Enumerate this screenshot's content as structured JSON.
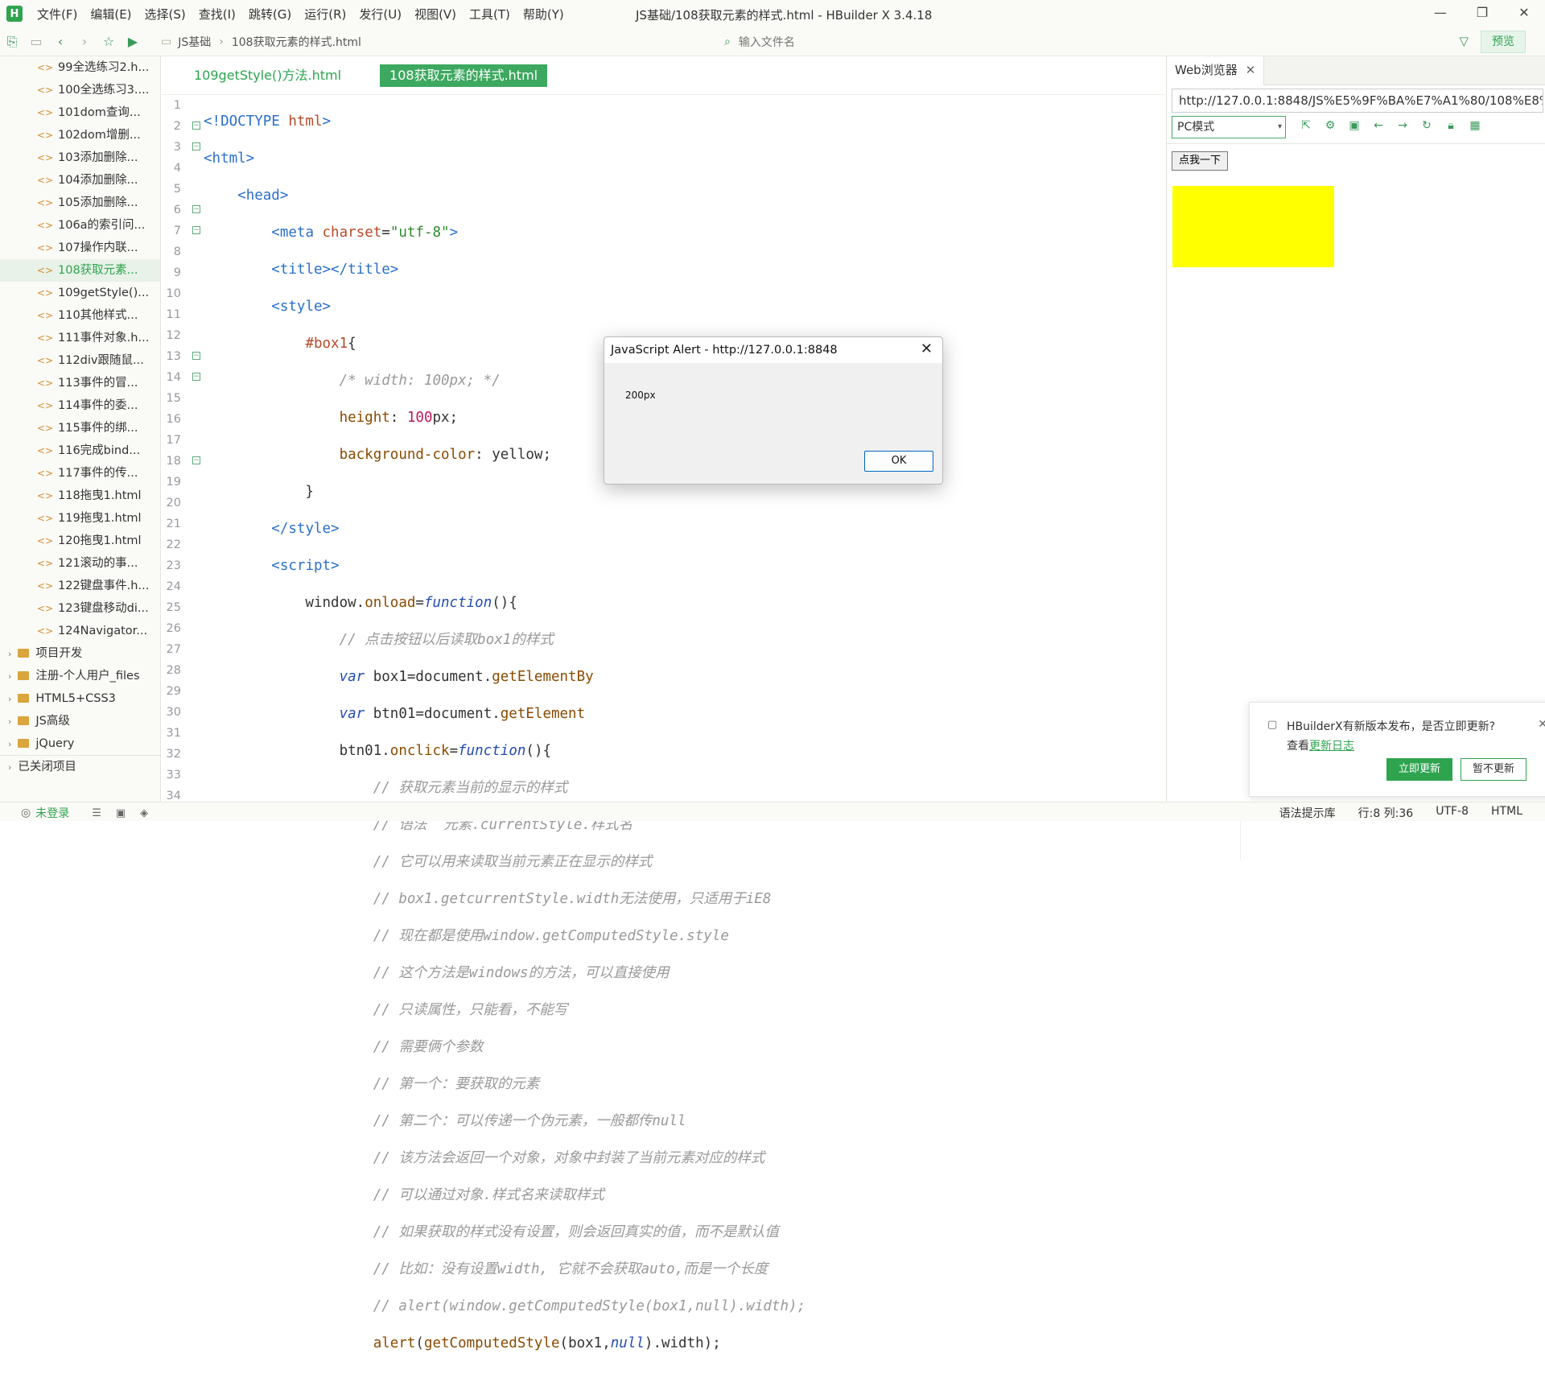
{
  "app": {
    "title": "JS基础/108获取元素的样式.html - HBuilder X 3.4.18",
    "logo_letter": "H",
    "menu": [
      "文件(F)",
      "编辑(E)",
      "选择(S)",
      "查找(I)",
      "跳转(G)",
      "运行(R)",
      "发行(U)",
      "视图(V)",
      "工具(T)",
      "帮助(Y)"
    ],
    "window_controls": [
      "—",
      "❐",
      "✕"
    ]
  },
  "toolbar": {
    "breadcrumb": [
      "JS基础",
      "108获取元素的样式.html"
    ],
    "file_search_placeholder": "输入文件名",
    "preview_label": "预览"
  },
  "sidebar": {
    "files": [
      {
        "icon": "<>",
        "label": "99全选练习2.h..."
      },
      {
        "icon": "<>",
        "label": "100全选练习3...."
      },
      {
        "icon": "<>",
        "label": "101dom查询..."
      },
      {
        "icon": "<>",
        "label": "102dom增删..."
      },
      {
        "icon": "<>",
        "label": "103添加删除..."
      },
      {
        "icon": "<>",
        "label": "104添加删除..."
      },
      {
        "icon": "<>",
        "label": "105添加删除..."
      },
      {
        "icon": "<>",
        "label": "106a的索引问..."
      },
      {
        "icon": "<>",
        "label": "107操作内联..."
      },
      {
        "icon": "<>",
        "label": "108获取元素...",
        "active": true
      },
      {
        "icon": "<>",
        "label": "109getStyle()..."
      },
      {
        "icon": "<>",
        "label": "110其他样式..."
      },
      {
        "icon": "<>",
        "label": "111事件对象.h..."
      },
      {
        "icon": "<>",
        "label": "112div跟随鼠..."
      },
      {
        "icon": "<>",
        "label": "113事件的冒..."
      },
      {
        "icon": "<>",
        "label": "114事件的委..."
      },
      {
        "icon": "<>",
        "label": "115事件的绑..."
      },
      {
        "icon": "<>",
        "label": "116完成bind..."
      },
      {
        "icon": "<>",
        "label": "117事件的传..."
      },
      {
        "icon": "<>",
        "label": "118拖曳1.html"
      },
      {
        "icon": "<>",
        "label": "119拖曳1.html"
      },
      {
        "icon": "<>",
        "label": "120拖曳1.html"
      },
      {
        "icon": "<>",
        "label": "121滚动的事..."
      },
      {
        "icon": "<>",
        "label": "122键盘事件.h..."
      },
      {
        "icon": "<>",
        "label": "123键盘移动di..."
      },
      {
        "icon": "<>",
        "label": "124Navigator..."
      }
    ],
    "folders": [
      "项目开发",
      "注册-个人用户_files",
      "HTML5+CSS3",
      "JS高级",
      "jQuery"
    ],
    "closed_projects": "已关闭项目"
  },
  "editor": {
    "tabs": [
      "109getStyle()方法.html",
      "108获取元素的样式.html"
    ],
    "line_numbers": [
      "1",
      "2",
      "3",
      "4",
      "5",
      "6",
      "7",
      "8",
      "9",
      "10",
      "11",
      "12",
      "13",
      "14",
      "15",
      "16",
      "17",
      "18",
      "19",
      "20",
      "21",
      "22",
      "23",
      "24",
      "25",
      "26",
      "27",
      "28",
      "29",
      "30",
      "31",
      "32",
      "33",
      "34"
    ]
  },
  "browser": {
    "tab_label": "Web浏览器",
    "url": "http://127.0.0.1:8848/JS%E5%9F%BA%E7%A1%80/108%E8%8E%",
    "mode": "PC模式",
    "page_button": "点我一下",
    "box_color": "#ffff00"
  },
  "alert": {
    "title": "JavaScript Alert - http://127.0.0.1:8848",
    "message": "200px",
    "ok": "OK"
  },
  "notification": {
    "message": "HBuilderX有新版本发布，是否立即更新?",
    "prefix": "查看",
    "link": "更新日志",
    "update_now": "立即更新",
    "later": "暂不更新"
  },
  "statusbar": {
    "login": "未登录",
    "hint_lib": "语法提示库",
    "position": "行:8  列:36",
    "encoding": "UTF-8",
    "language": "HTML"
  },
  "colors": {
    "accent": "#2ea44f",
    "active_tab": "#3da85f"
  }
}
